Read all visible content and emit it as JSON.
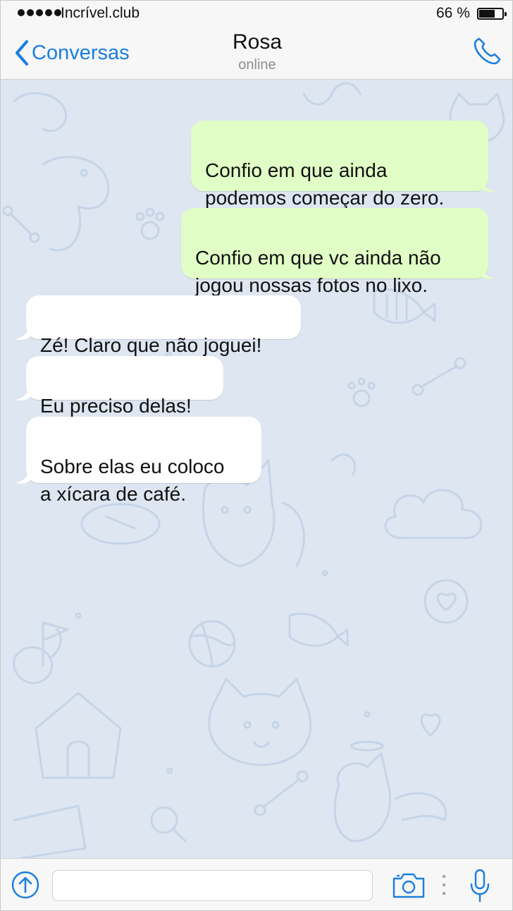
{
  "status_bar": {
    "carrier": "Incrível.club",
    "battery_percent": "66 %",
    "battery_level": 0.66
  },
  "nav": {
    "back_label": "Conversas",
    "contact_name": "Rosa",
    "contact_status": "online"
  },
  "messages": [
    {
      "direction": "outgoing",
      "text": "Confio em que ainda\npodemos começar do zero."
    },
    {
      "direction": "outgoing",
      "text": "Confio em que vc ainda não\njogou nossas fotos no lixo."
    },
    {
      "direction": "incoming",
      "text": "Zé! Claro que não joguei!"
    },
    {
      "direction": "incoming",
      "text": "Eu preciso delas!"
    },
    {
      "direction": "incoming",
      "text": "Sobre elas eu coloco\na xícara de café."
    }
  ],
  "input": {
    "value": "",
    "placeholder": ""
  },
  "colors": {
    "accent": "#1a7ee0",
    "outgoing_bubble": "#e1fec6",
    "incoming_bubble": "#ffffff",
    "chat_background": "#dde6f1"
  },
  "icons": [
    "back-chevron-icon",
    "phone-icon",
    "attach-arrow-icon",
    "camera-icon",
    "more-dots-icon",
    "microphone-icon"
  ]
}
